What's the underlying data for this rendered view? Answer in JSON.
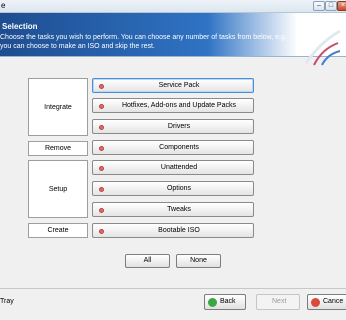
{
  "window": {
    "title": "e"
  },
  "header": {
    "title": "Selection",
    "description_line1": "Choose the tasks you wish to perform. You can choose any number of tasks from below, e.g.",
    "description_line2": "you can choose to make an ISO and skip the rest."
  },
  "groups": [
    {
      "label": "Integrate"
    },
    {
      "label": "Remove"
    },
    {
      "label": "Setup"
    },
    {
      "label": "Create"
    }
  ],
  "tasks": [
    {
      "label": "Service Pack"
    },
    {
      "label": "Hotfixes, Add-ons and Update Packs"
    },
    {
      "label": "Drivers"
    },
    {
      "label": "Components"
    },
    {
      "label": "Unattended"
    },
    {
      "label": "Options"
    },
    {
      "label": "Tweaks"
    },
    {
      "label": "Bootable ISO"
    }
  ],
  "selection": {
    "all_label": "All",
    "none_label": "None"
  },
  "footer": {
    "tray_label": "Tray",
    "back_label": "Back",
    "next_label": "Next",
    "cancel_label": "Cance"
  },
  "icons": {
    "header_logo": "swoosh-logo-icon",
    "task_marker": "red-dot-icon",
    "back": "green-arrow-icon",
    "cancel": "red-x-icon"
  }
}
